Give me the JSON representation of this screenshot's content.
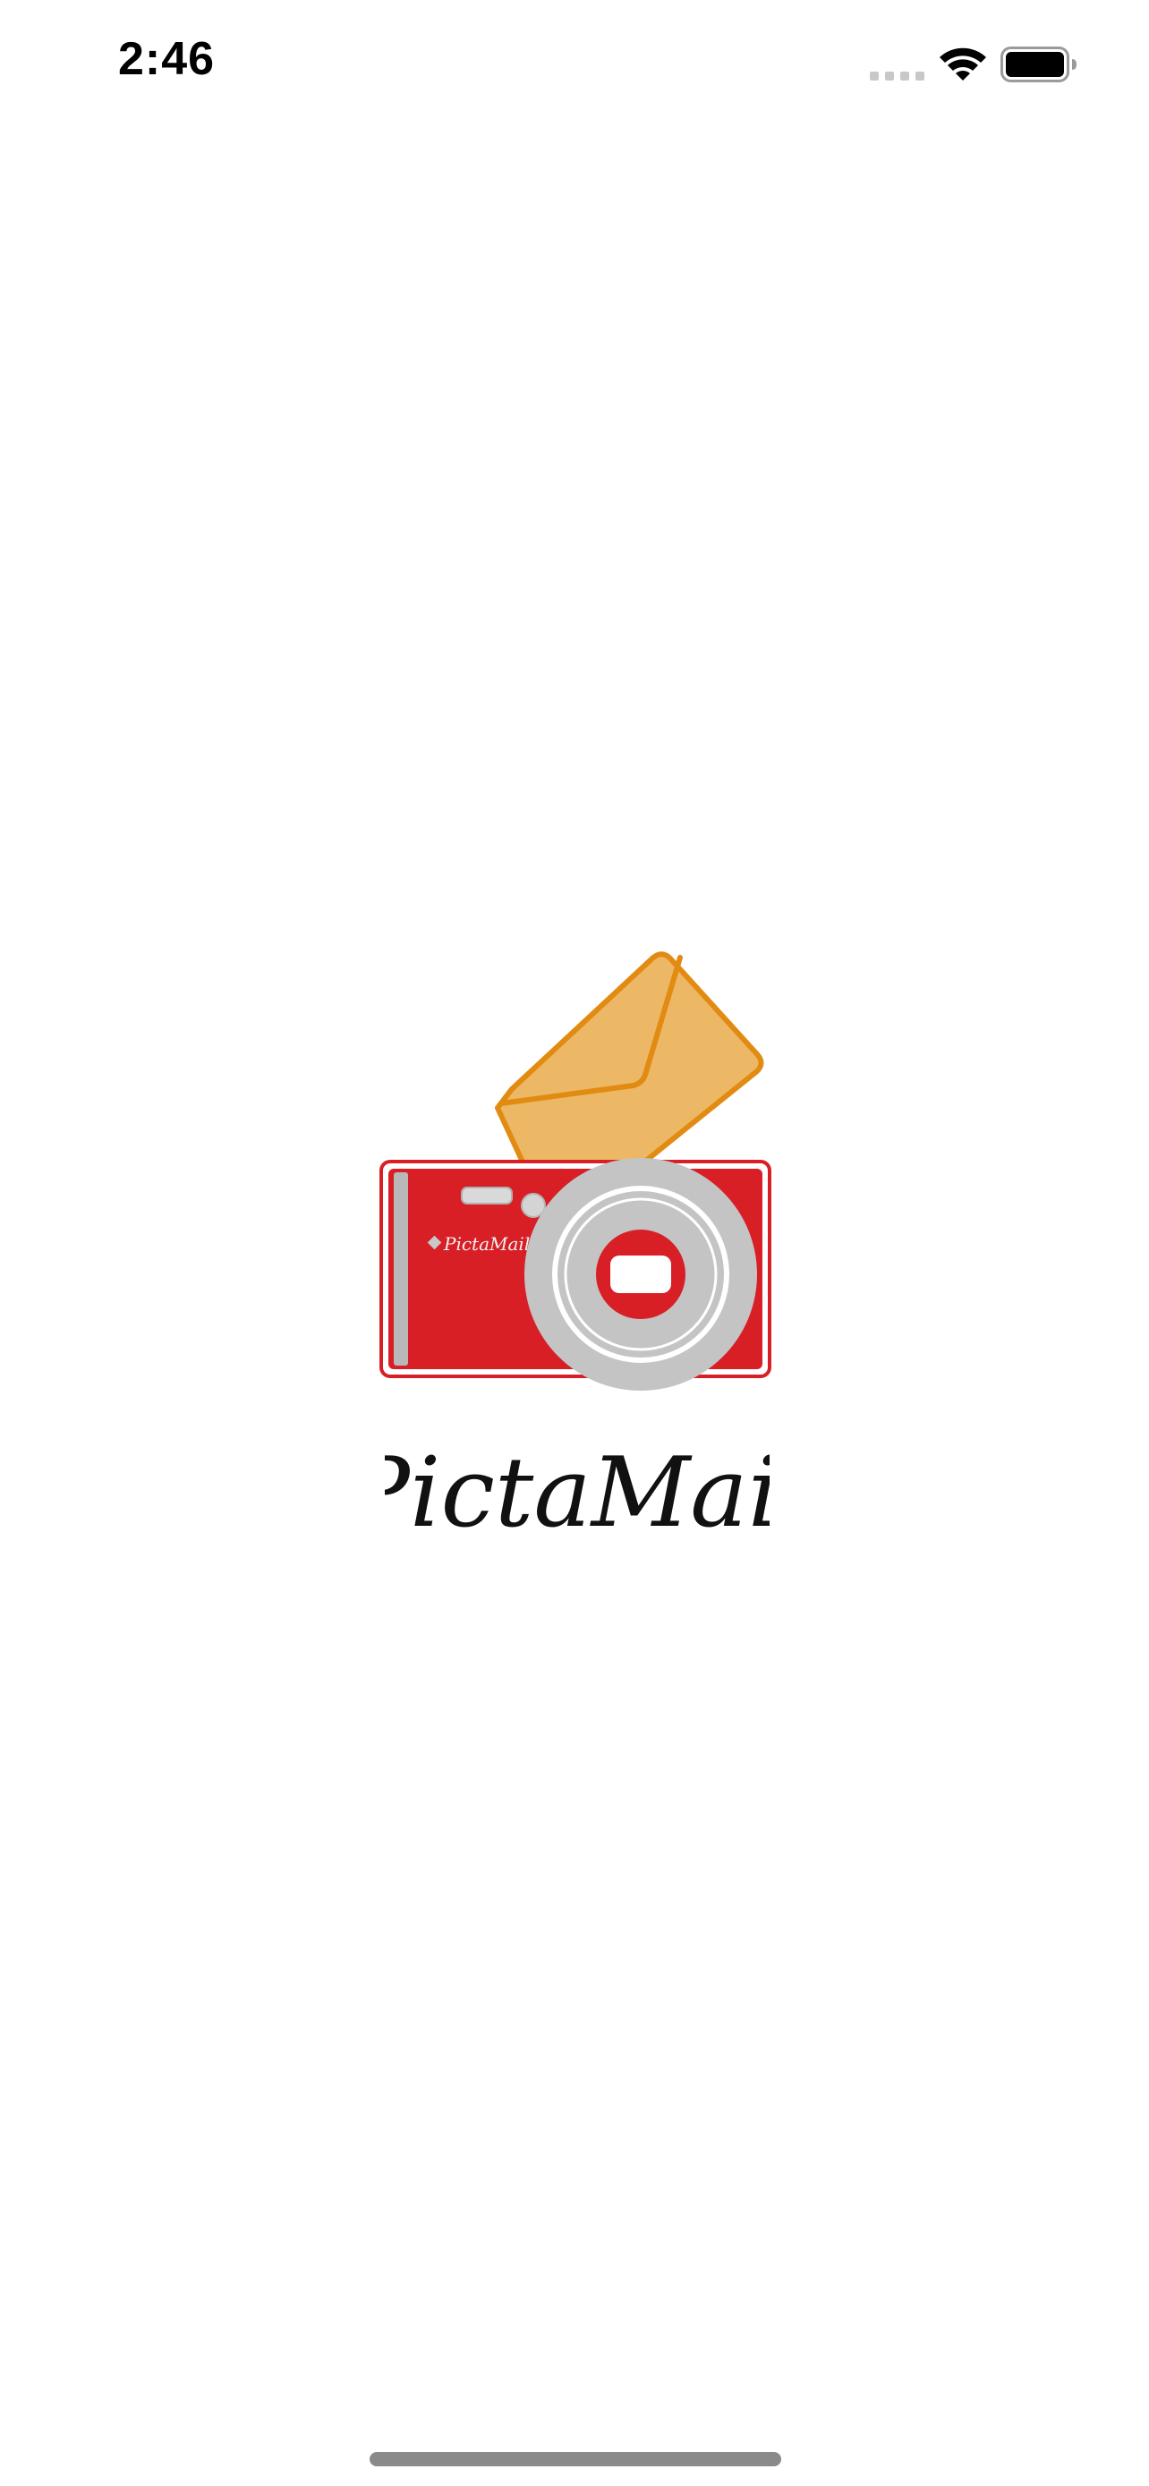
{
  "status_bar": {
    "time": "2:46",
    "signal_icon": "cellular-signal-icon",
    "wifi_icon": "wifi-icon",
    "battery_icon": "battery-icon"
  },
  "splash": {
    "app_name": "PictaMail",
    "camera_badge_text": "PictaMail",
    "logo_icon": "camera-with-envelope-logo",
    "colors": {
      "camera_red": "#d81f26",
      "envelope_fill": "#edb865",
      "envelope_stroke": "#e28b12",
      "lens_gray": "#c4c4c4"
    }
  },
  "home_indicator": {
    "icon": "home-indicator-bar"
  }
}
